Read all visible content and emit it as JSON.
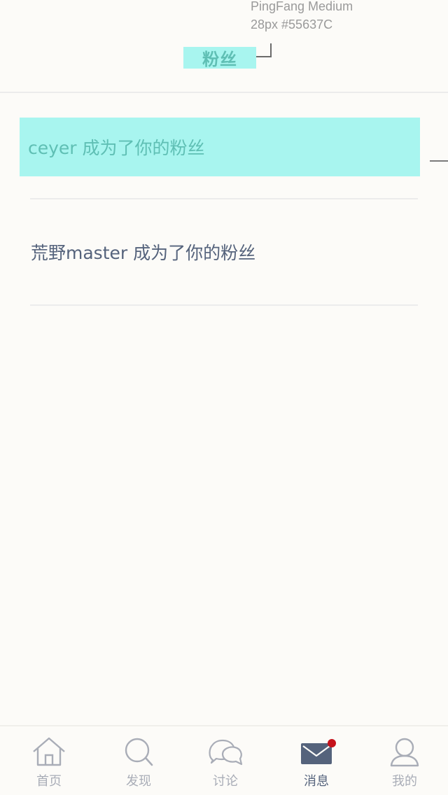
{
  "annotation": {
    "font": "PingFang Medium",
    "spec": "28px #55637C"
  },
  "header": {
    "title": "粉丝"
  },
  "notifications": [
    {
      "text": "ceyer 成为了你的粉丝",
      "highlight_color": "#A8F5EF"
    },
    {
      "text": "荒野master 成为了你的粉丝"
    }
  ],
  "tabbar": {
    "tabs": [
      {
        "label": "首页",
        "icon": "home-icon",
        "active": false
      },
      {
        "label": "发现",
        "icon": "search-icon",
        "active": false
      },
      {
        "label": "讨论",
        "icon": "chat-bubbles-icon",
        "active": false
      },
      {
        "label": "消息",
        "icon": "mail-icon",
        "active": true,
        "badge": true
      },
      {
        "label": "我的",
        "icon": "user-icon",
        "active": false
      }
    ]
  },
  "colors": {
    "background": "#FCFBF8",
    "text": "#55637C",
    "highlight": "#A8F5EF",
    "inactive_tab": "#A9ADB7",
    "badge": "#C5121B"
  }
}
